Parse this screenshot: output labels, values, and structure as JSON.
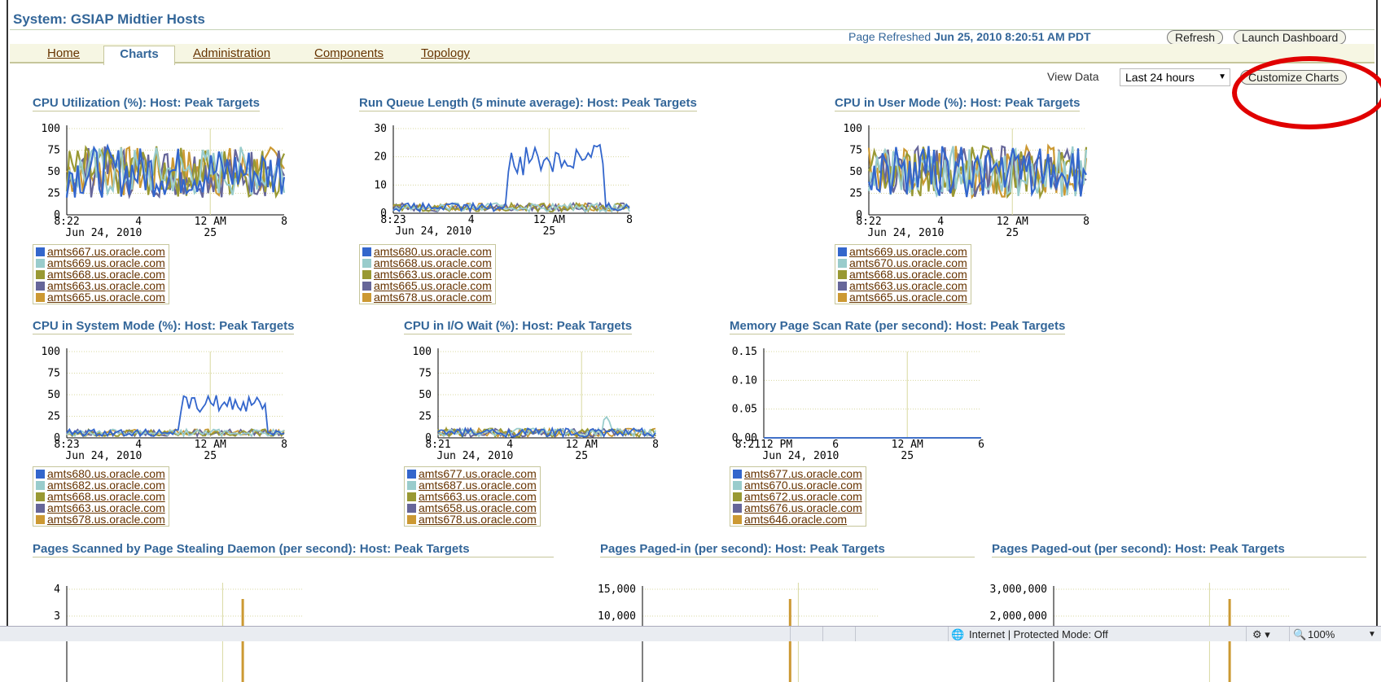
{
  "window": {
    "title": "System: GSIAP Midtier Hosts"
  },
  "refresh": {
    "label": "Page Refreshed",
    "timestamp": "Jun 25, 2010 8:20:51 AM PDT"
  },
  "buttons": {
    "refresh": "Refresh",
    "launch_dashboard": "Launch Dashboard",
    "customize_charts": "Customize Charts"
  },
  "tabs": [
    {
      "label": "Home"
    },
    {
      "label": "Charts",
      "active": true
    },
    {
      "label": "Administration"
    },
    {
      "label": "Components"
    },
    {
      "label": "Topology"
    }
  ],
  "view_data": {
    "label": "View Data",
    "selected": "Last 24 hours"
  },
  "colors": {
    "series": [
      "#3366cc",
      "#99cccc",
      "#999933",
      "#666699",
      "#cc9933"
    ],
    "title": "#336699",
    "link": "#663300",
    "highlight": "#e00000"
  },
  "charts": [
    {
      "title": "CPU Utilization (%): Host: Peak Targets",
      "chart_data": {
        "type": "line",
        "y_ticks": [
          "100",
          "75",
          "50",
          "25",
          "0"
        ],
        "x_ticks": [
          "8:22",
          "4",
          "12 AM",
          "8"
        ],
        "x_sub": [
          "Jun 24, 2010",
          "25"
        ],
        "ylim": [
          0,
          100
        ]
      },
      "legend": [
        "amts667.us.oracle.com",
        "amts669.us.oracle.com",
        "amts668.us.oracle.com",
        "amts663.us.oracle.com",
        "amts665.us.oracle.com"
      ]
    },
    {
      "title": "Run Queue Length (5 minute average): Host: Peak Targets",
      "chart_data": {
        "type": "line",
        "y_ticks": [
          "30",
          "20",
          "10",
          "0"
        ],
        "x_ticks": [
          "8:23",
          "4",
          "12 AM",
          "8"
        ],
        "x_sub": [
          "Jun 24, 2010",
          "25"
        ],
        "ylim": [
          0,
          30
        ]
      },
      "legend": [
        "amts680.us.oracle.com",
        "amts668.us.oracle.com",
        "amts663.us.oracle.com",
        "amts665.us.oracle.com",
        "amts678.us.oracle.com"
      ]
    },
    {
      "title": "CPU in User Mode (%): Host: Peak Targets",
      "chart_data": {
        "type": "line",
        "y_ticks": [
          "100",
          "75",
          "50",
          "25",
          "0"
        ],
        "x_ticks": [
          "8:22",
          "4",
          "12 AM",
          "8"
        ],
        "x_sub": [
          "Jun 24, 2010",
          "25"
        ],
        "ylim": [
          0,
          100
        ]
      },
      "legend": [
        "amts669.us.oracle.com",
        "amts670.us.oracle.com",
        "amts668.us.oracle.com",
        "amts663.us.oracle.com",
        "amts665.us.oracle.com"
      ]
    },
    {
      "title": "CPU in System Mode (%): Host: Peak Targets",
      "chart_data": {
        "type": "line",
        "y_ticks": [
          "100",
          "75",
          "50",
          "25",
          "0"
        ],
        "x_ticks": [
          "8:23",
          "4",
          "12 AM",
          "8"
        ],
        "x_sub": [
          "Jun 24, 2010",
          "25"
        ],
        "ylim": [
          0,
          100
        ]
      },
      "legend": [
        "amts680.us.oracle.com",
        "amts682.us.oracle.com",
        "amts668.us.oracle.com",
        "amts663.us.oracle.com",
        "amts678.us.oracle.com"
      ]
    },
    {
      "title": "CPU in I/O Wait (%): Host: Peak Targets",
      "chart_data": {
        "type": "line",
        "y_ticks": [
          "100",
          "75",
          "50",
          "25",
          "0"
        ],
        "x_ticks": [
          "8:21",
          "4",
          "12 AM",
          "8"
        ],
        "x_sub": [
          "Jun 24, 2010",
          "25"
        ],
        "ylim": [
          0,
          100
        ]
      },
      "legend": [
        "amts677.us.oracle.com",
        "amts687.us.oracle.com",
        "amts663.us.oracle.com",
        "amts658.us.oracle.com",
        "amts678.us.oracle.com"
      ]
    },
    {
      "title": "Memory Page Scan Rate (per second): Host: Peak Targets",
      "chart_data": {
        "type": "line",
        "y_ticks": [
          "0.15",
          "0.10",
          "0.05",
          "0.00"
        ],
        "x_ticks": [
          "8:2112 PM",
          "6",
          "12 AM",
          "6"
        ],
        "x_sub": [
          "Jun 24, 2010",
          "25"
        ],
        "ylim": [
          0,
          0.15
        ]
      },
      "legend": [
        "amts677.us.oracle.com",
        "amts670.us.oracle.com",
        "amts672.us.oracle.com",
        "amts676.us.oracle.com",
        "amts646.oracle.com"
      ]
    },
    {
      "title": "Pages Scanned by Page Stealing Daemon (per second): Host: Peak Targets",
      "chart_data": {
        "type": "bar",
        "y_ticks": [
          "4",
          "3"
        ]
      }
    },
    {
      "title": "Pages Paged-in (per second): Host: Peak Targets",
      "chart_data": {
        "type": "bar",
        "y_ticks": [
          "15,000",
          "10,000"
        ]
      }
    },
    {
      "title": "Pages Paged-out (per second): Host: Peak Targets",
      "chart_data": {
        "type": "bar",
        "y_ticks": [
          "3,000,000",
          "2,000,000"
        ]
      }
    }
  ],
  "status": {
    "zone": "Internet | Protected Mode: Off",
    "zoom": "100%"
  }
}
